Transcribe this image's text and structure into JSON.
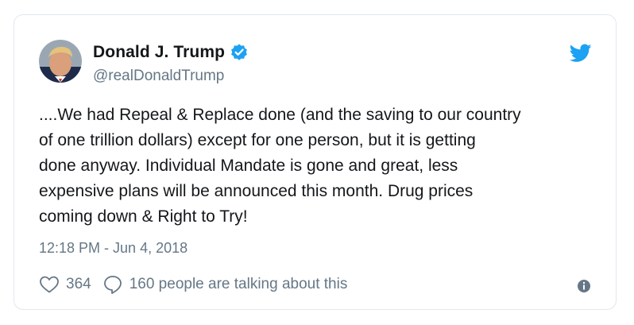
{
  "tweet": {
    "author_name": "Donald J. Trump",
    "handle": "@realDonaldTrump",
    "verified": true,
    "text": "....We had Repeal & Replace done (and the saving to our country\nof one trillion dollars) except for one person, but it is getting\ndone anyway. Individual Mandate is gone and great, less\nexpensive plans will be announced this month. Drug prices\ncoming down & Right to Try!",
    "timestamp": "12:18 PM - Jun 4, 2018",
    "like_count": "364",
    "talking_text": "160 people are talking about this"
  },
  "icons": {
    "verified": "verified-badge-icon",
    "logo": "twitter-bird-icon",
    "like": "heart-icon",
    "reply": "speech-bubble-icon",
    "info": "info-icon"
  },
  "colors": {
    "accent": "#1da1f2",
    "text": "#14171a",
    "secondary": "#657786",
    "border": "#e1e8ed"
  }
}
